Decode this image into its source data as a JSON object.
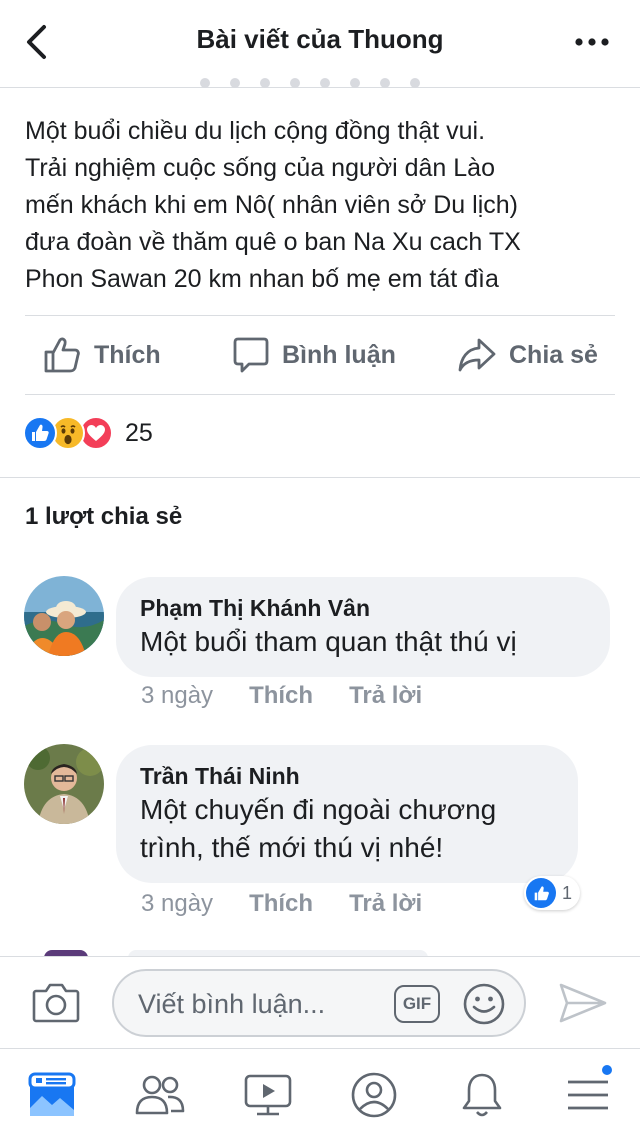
{
  "header": {
    "title": "Bài viết của Thuong",
    "back_icon": "chevron-left-icon",
    "more_icon": "more-horizontal-icon"
  },
  "post": {
    "text_lines": [
      "Một buổi chiều du lịch cộng đồng thật vui.",
      "Trải nghiệm cuộc sống của người dân Lào",
      "mến khách khi em Nô( nhân viên sở Du lịch)",
      "đưa đoàn về thăm quê o ban Na Xu  cach TX",
      "Phon Sawan 20 km nhan bố mẹ em tát đìa"
    ]
  },
  "actions": {
    "like_label": "Thích",
    "comment_label": "Bình luận",
    "share_label": "Chia sẻ"
  },
  "reactions": {
    "count": "25",
    "types": [
      "like",
      "wow",
      "love"
    ]
  },
  "shares": {
    "label": "1 lượt chia sẻ"
  },
  "comments": [
    {
      "name": "Phạm Thị Khánh Vân",
      "text": "Một buổi tham quan thật thú vị",
      "time": "3 ngày",
      "like_label": "Thích",
      "reply_label": "Trả lời"
    },
    {
      "name": "Trần Thái Ninh",
      "text_lines": [
        "Một chuyến đi ngoài chương",
        "trình, thế mới thú vị nhé!"
      ],
      "time": "3 ngày",
      "like_label": "Thích",
      "reply_label": "Trả lời",
      "like_count": "1"
    }
  ],
  "composer": {
    "placeholder": "Viết bình luận...",
    "gif_label": "GIF"
  },
  "tabbar": {
    "items": [
      "news-feed",
      "friends",
      "watch",
      "profile",
      "notifications",
      "menu"
    ]
  },
  "colors": {
    "accent": "#1877f2",
    "love": "#f33e58",
    "wow": "#f7b928",
    "text_secondary": "#606770"
  }
}
